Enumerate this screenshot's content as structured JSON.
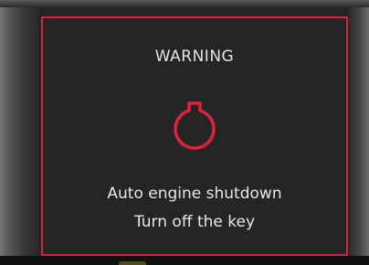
{
  "warning": {
    "title": "WARNING",
    "icon": "engine-shutdown-icon",
    "line1": "Auto engine shutdown",
    "line2": "Turn off the key"
  },
  "colors": {
    "frame": "#d8233a",
    "icon": "#e0233c",
    "text": "#e8e8e8",
    "background": "#252525"
  }
}
